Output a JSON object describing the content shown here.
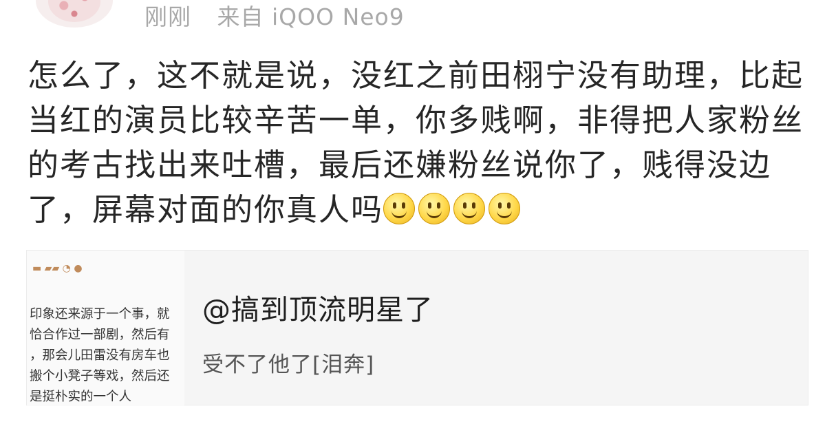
{
  "header": {
    "time": "刚刚",
    "source": "来自 iQOO Neo9"
  },
  "post": {
    "text": "怎么了，这不就是说，没红之前田栩宁没有助理，比起当红的演员比较辛苦一单，你多贱啊，非得把人家粉丝的考古找出来吐槽，最后还嫌粉丝说你了，贱得没边了，屏幕对面的你真人吗",
    "emoji": [
      "smile-icon",
      "smile-icon",
      "smile-icon",
      "smile-icon"
    ]
  },
  "quote_card": {
    "thumbnail_lines": [
      "印象还来源于一个事，就",
      "恰合作过一部剧，然后有",
      "，那会儿田雷没有房车也",
      "搬个小凳子等戏，然后还",
      "是挺朴实的一个人"
    ],
    "title": "@搞到顶流明星了",
    "description": "受不了他了[泪奔]"
  }
}
